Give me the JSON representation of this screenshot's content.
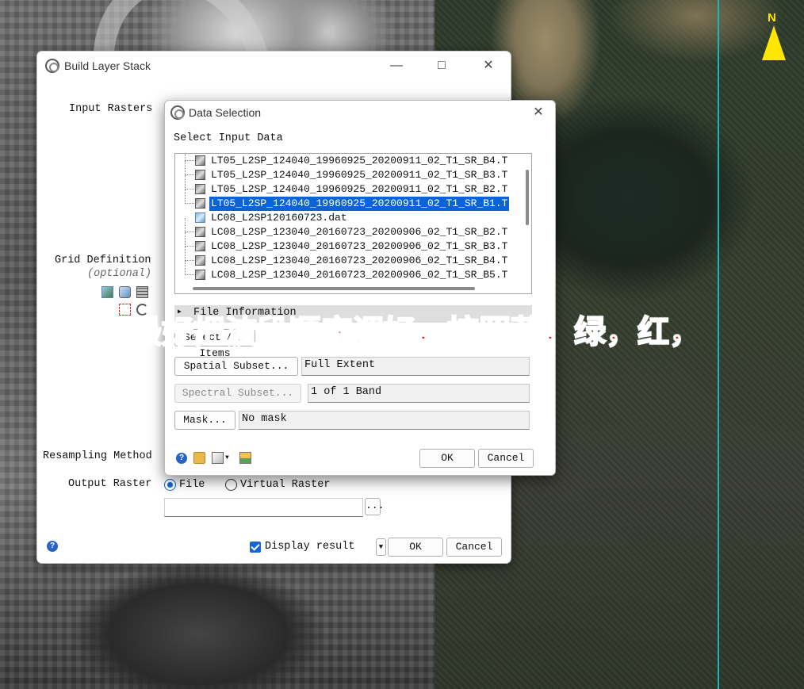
{
  "background": {
    "north_label": "N"
  },
  "build_layer_stack": {
    "title": "Build Layer Stack",
    "minimize": "—",
    "maximize": "□",
    "close": "✕",
    "input_rasters_label": "Input Rasters",
    "grid_definition_label": "Grid Definition",
    "grid_definition_optional": "(optional)",
    "resampling_method_label": "Resampling Method",
    "output_raster_label": "Output Raster",
    "output_options": [
      "File",
      "Virtual Raster"
    ],
    "output_selected": "File",
    "output_path": "",
    "browse_label": "...",
    "display_result_label": "Display result",
    "display_result_checked": true,
    "ok_label": "OK",
    "cancel_label": "Cancel",
    "help_icon": "help-icon"
  },
  "data_selection": {
    "title": "Data Selection",
    "close": "✕",
    "select_input_label": "Select Input Data",
    "files": [
      {
        "name": "LT05_L2SP_124040_19960925_20200911_02_T1_SR_B4.T",
        "type": "band",
        "selected": false
      },
      {
        "name": "LT05_L2SP_124040_19960925_20200911_02_T1_SR_B3.T",
        "type": "band",
        "selected": false
      },
      {
        "name": "LT05_L2SP_124040_19960925_20200911_02_T1_SR_B2.T",
        "type": "band",
        "selected": false
      },
      {
        "name": "LT05_L2SP_124040_19960925_20200911_02_T1_SR_B1.T",
        "type": "band",
        "selected": true
      },
      {
        "name": "LC08_L2SP120160723.dat",
        "type": "dat",
        "selected": false
      },
      {
        "name": "LC08_L2SP_123040_20160723_20200906_02_T1_SR_B2.T",
        "type": "band",
        "selected": false
      },
      {
        "name": "LC08_L2SP_123040_20160723_20200906_02_T1_SR_B3.T",
        "type": "band",
        "selected": false
      },
      {
        "name": "LC08_L2SP_123040_20160723_20200906_02_T1_SR_B4.T",
        "type": "band",
        "selected": false
      },
      {
        "name": "LC08_L2SP_123040_20160723_20200906_02_T1_SR_B5.T",
        "type": "band",
        "selected": false
      }
    ],
    "file_information_label": "File Information",
    "select_all_label": "Select All Items",
    "spatial_subset_label": "Spatial Subset...",
    "spatial_subset_value": "Full Extent",
    "spectral_subset_label": "Spectral Subset...",
    "spectral_subset_value": "1 of 1 Band",
    "mask_label": "Mask...",
    "mask_value": "No mask",
    "ok_label": "OK",
    "cancel_label": "Cancel"
  },
  "annotation": {
    "text": "这里最好把波段顺序调好，按照蓝，绿，红，",
    "color": "#e02020"
  }
}
